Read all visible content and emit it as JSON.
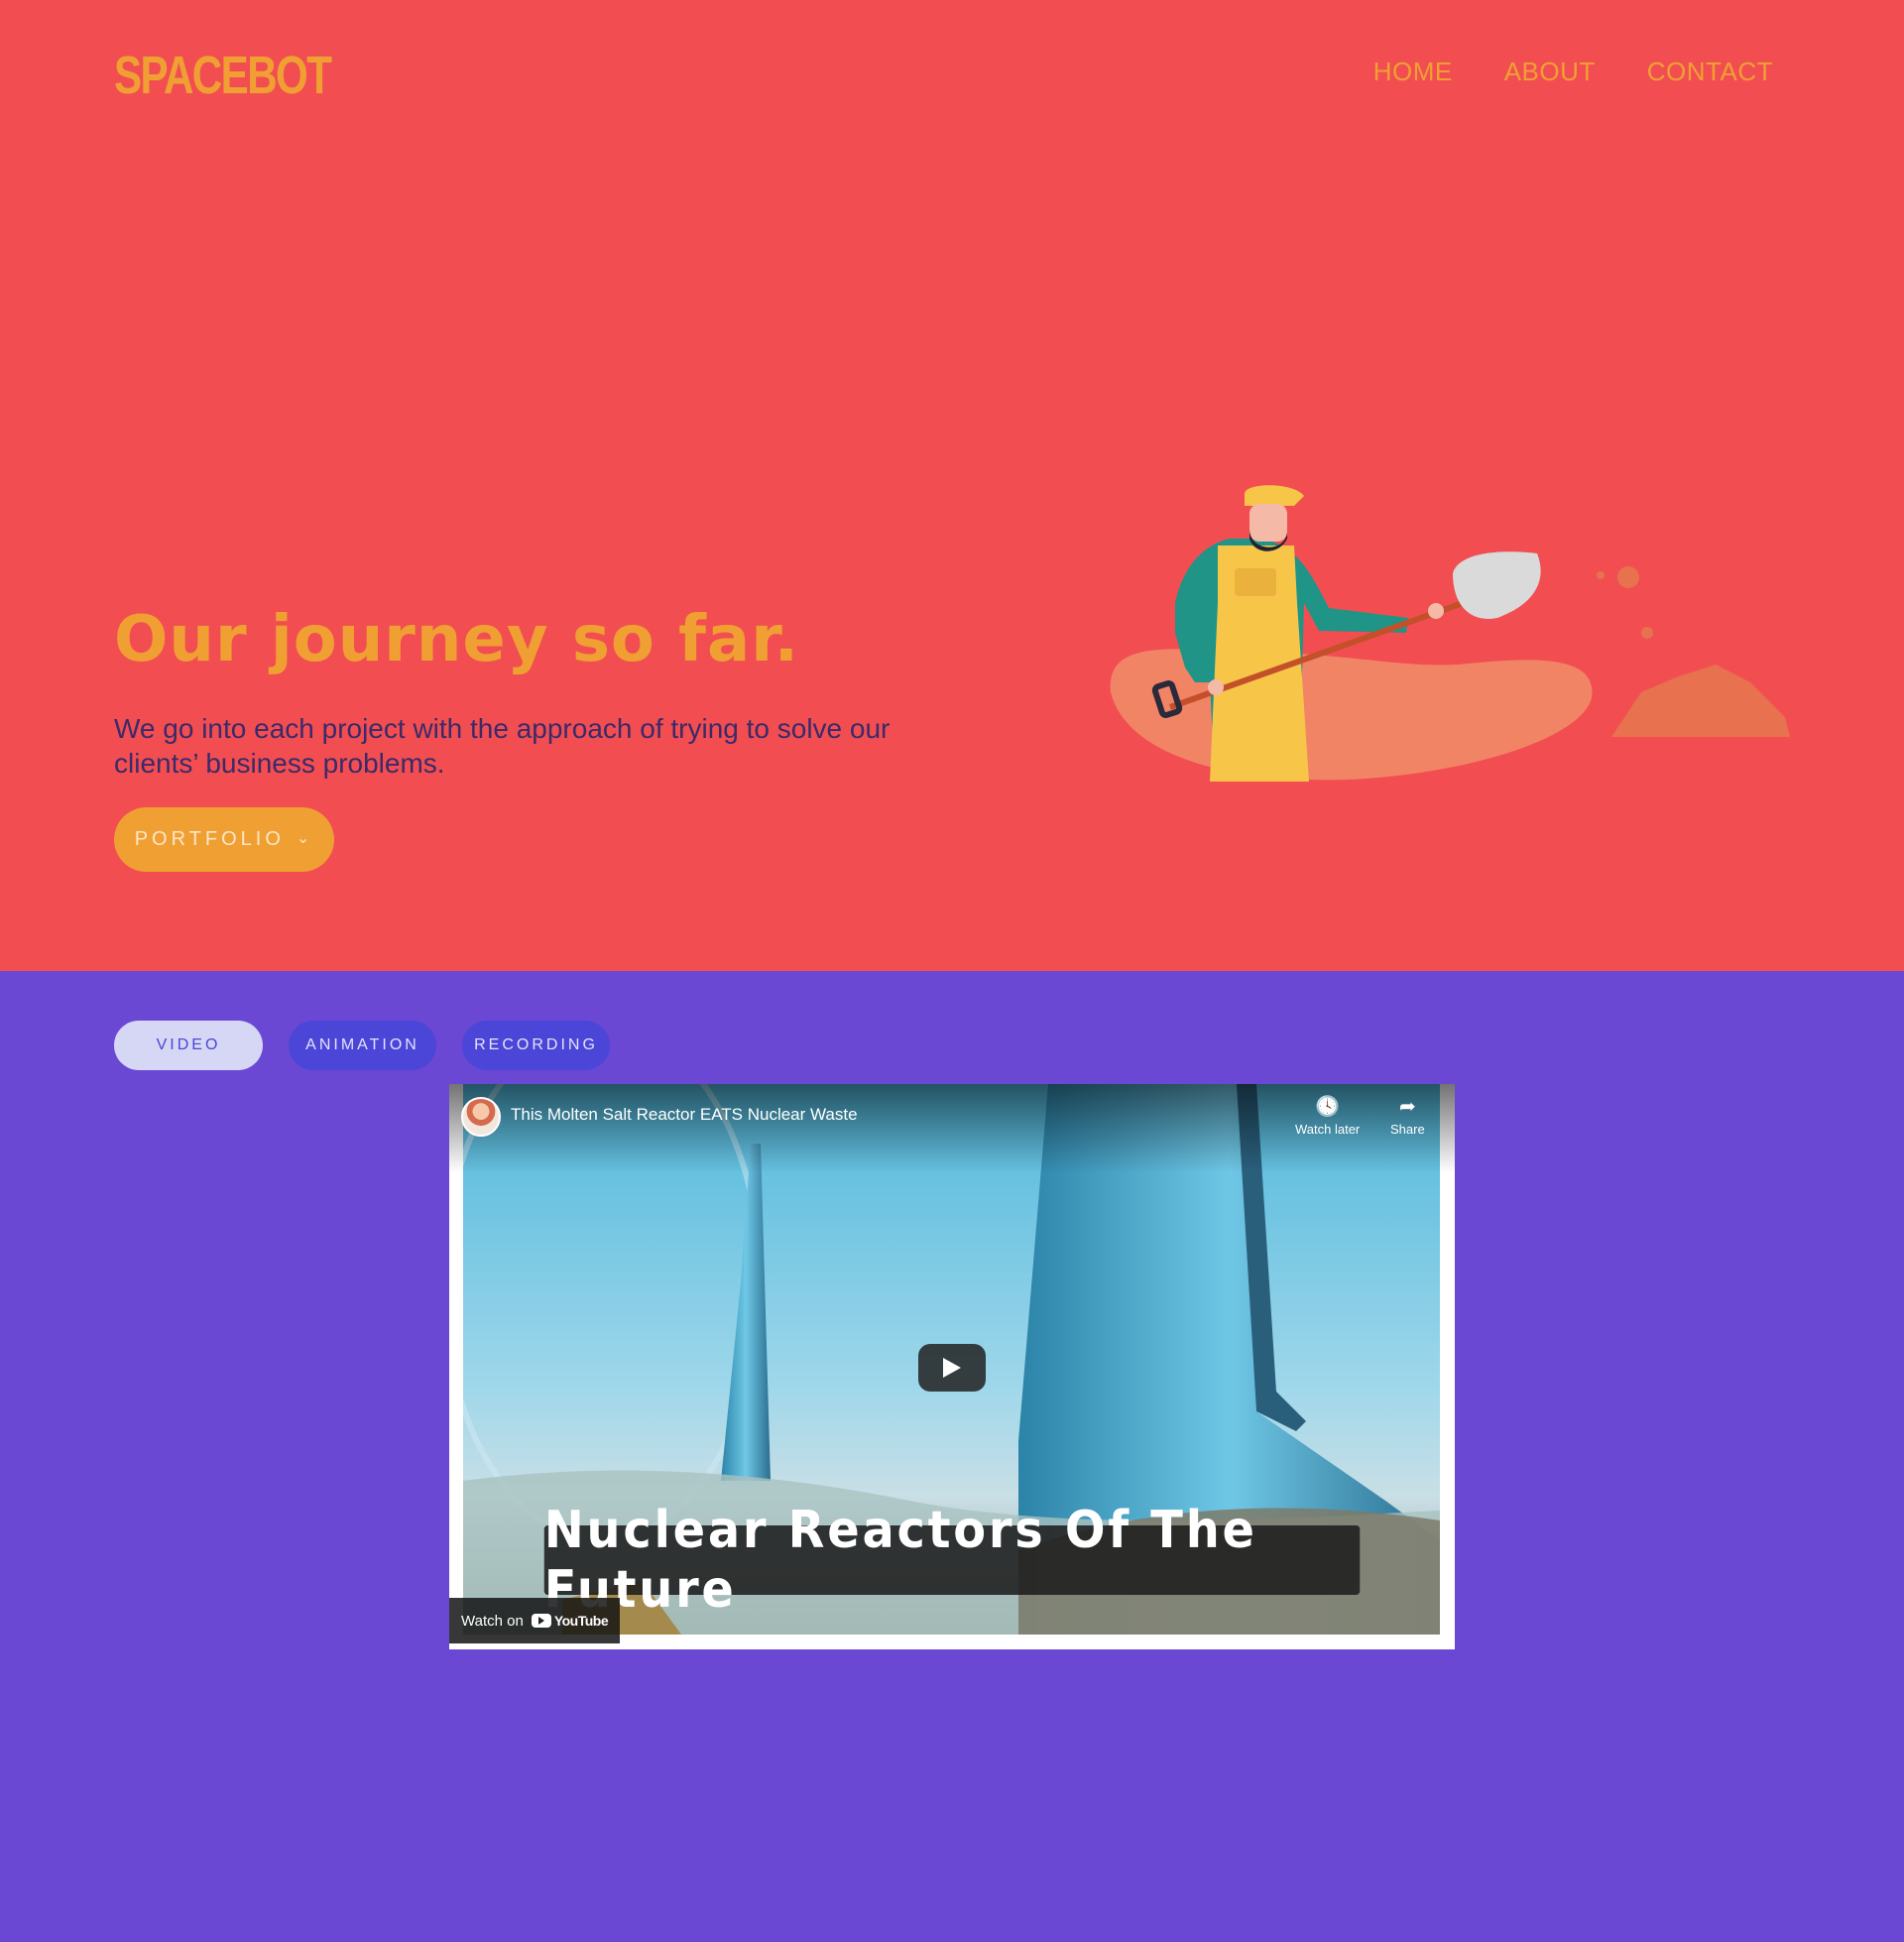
{
  "brand": {
    "logo_text": "SPACEBOT",
    "primary_color": "#f24e51",
    "accent_color": "#f0a033",
    "secondary_bg": "#6b48d3"
  },
  "nav": {
    "items": [
      {
        "label": "HOME"
      },
      {
        "label": "ABOUT"
      },
      {
        "label": "CONTACT"
      }
    ]
  },
  "hero": {
    "title": "Our journey so far.",
    "subtitle": "We go into each project with the approach of trying to solve our clients’ business problems.",
    "button_label": "PORTFOLIO",
    "button_icon": "chevron-down-icon"
  },
  "filters": {
    "tabs": [
      {
        "label": "VIDEO",
        "active": true
      },
      {
        "label": "ANIMATION",
        "active": false
      },
      {
        "label": "RECORDING",
        "active": false
      }
    ]
  },
  "video": {
    "title": "This Molten Salt Reactor EATS Nuclear Waste",
    "watch_later_label": "Watch later",
    "share_label": "Share",
    "caption": "Nuclear Reactors Of The Future",
    "watch_on_label": "Watch on",
    "platform_label": "YouTube"
  }
}
